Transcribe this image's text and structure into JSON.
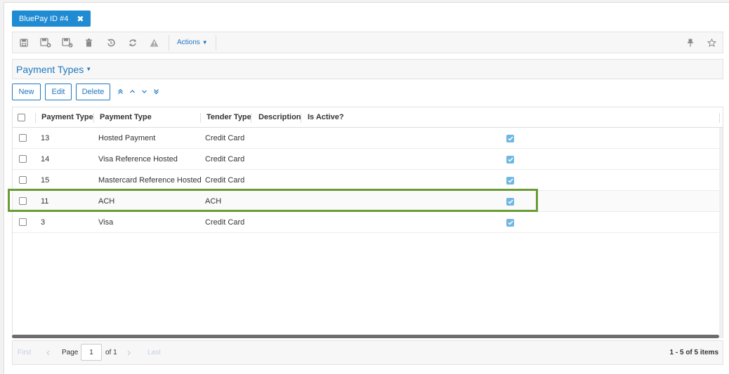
{
  "tab": {
    "title": "BluePay ID #4",
    "close_glyph": "✖"
  },
  "toolbar": {
    "icons": [
      "save-icon",
      "save-and-new-icon",
      "save-and-close-icon",
      "delete-icon",
      "undo-icon",
      "refresh-icon",
      "warning-icon"
    ],
    "actions_label": "Actions",
    "right_icons": [
      "pin-icon",
      "star-icon"
    ]
  },
  "section": {
    "title": "Payment Types"
  },
  "buttons": {
    "new": "New",
    "edit": "Edit",
    "delete": "Delete"
  },
  "grid": {
    "columns": [
      "Payment Type",
      "Payment Type",
      "Tender Type",
      "Description",
      "Is Active?"
    ],
    "rows": [
      {
        "id": "13",
        "name": "Hosted Payment",
        "tender": "Credit Card",
        "description": "",
        "active": true
      },
      {
        "id": "14",
        "name": "Visa Reference Hosted",
        "tender": "Credit Card",
        "description": "",
        "active": true
      },
      {
        "id": "15",
        "name": "Mastercard Reference Hosted",
        "tender": "Credit Card",
        "description": "",
        "active": true
      },
      {
        "id": "11",
        "name": "ACH",
        "tender": "ACH",
        "description": "",
        "active": true
      },
      {
        "id": "3",
        "name": "Visa",
        "tender": "Credit Card",
        "description": "",
        "active": true
      }
    ],
    "highlighted_row_index": 3
  },
  "pager": {
    "first": "First",
    "last": "Last",
    "page_label": "Page",
    "page_value": "1",
    "of_label": "of 1",
    "count": "1 - 5 of 5 items"
  },
  "colors": {
    "accent": "#1e77c0",
    "tab_bg": "#1e8bd3",
    "highlight": "#6a9c35",
    "check": "#6fb7e2"
  }
}
